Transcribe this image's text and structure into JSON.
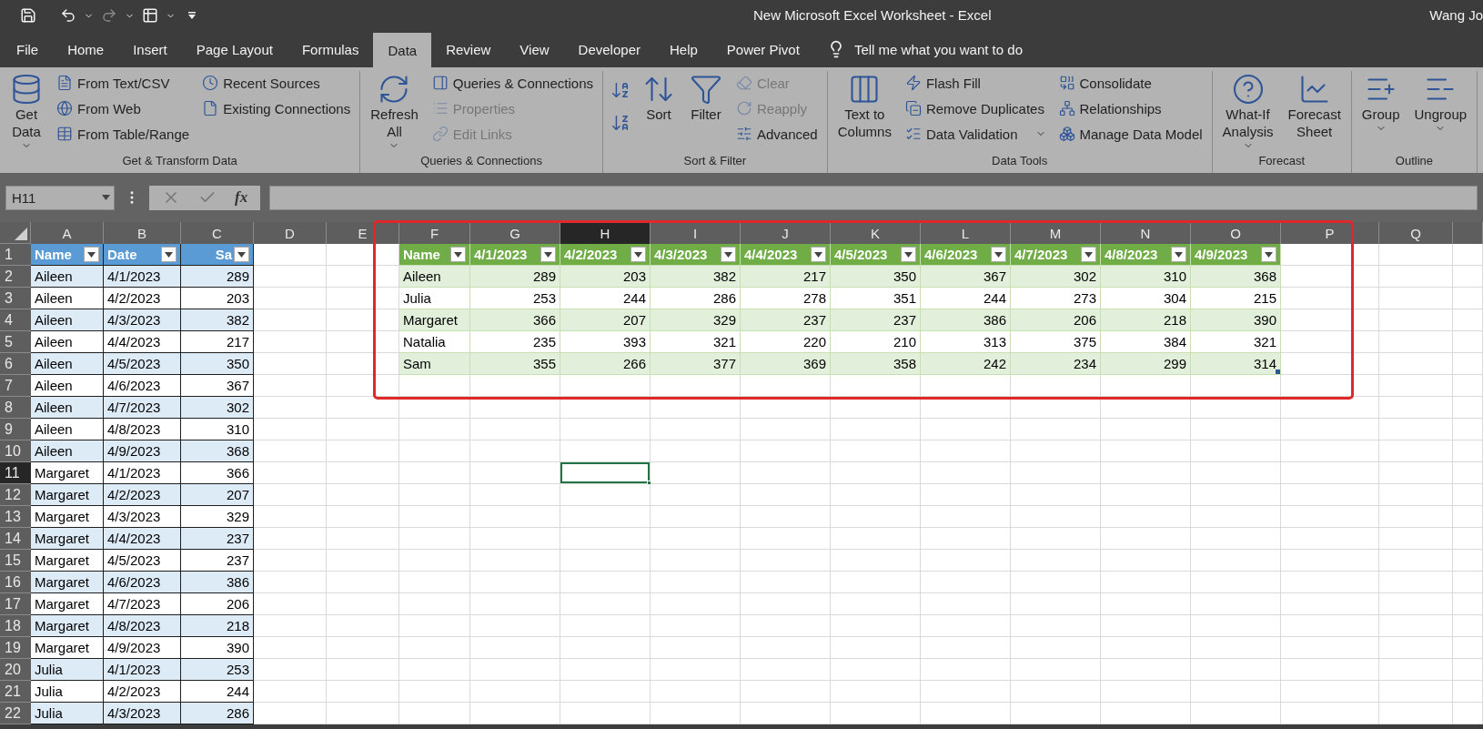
{
  "window": {
    "title": "New Microsoft Excel Worksheet  -  Excel",
    "user": "Wang Jo"
  },
  "tabs": [
    {
      "label": "File",
      "selected": false
    },
    {
      "label": "Home",
      "selected": false
    },
    {
      "label": "Insert",
      "selected": false
    },
    {
      "label": "Page Layout",
      "selected": false
    },
    {
      "label": "Formulas",
      "selected": false
    },
    {
      "label": "Data",
      "selected": true
    },
    {
      "label": "Review",
      "selected": false
    },
    {
      "label": "View",
      "selected": false
    },
    {
      "label": "Developer",
      "selected": false
    },
    {
      "label": "Help",
      "selected": false
    },
    {
      "label": "Power Pivot",
      "selected": false
    }
  ],
  "tell_me": "Tell me what you want to do",
  "ribbon": [
    {
      "label": "Get & Transform Data",
      "columns": [
        {
          "kind": "large",
          "label": "Get\nData",
          "caret": true
        },
        {
          "kind": "stack",
          "items": [
            {
              "label": "From Text/CSV",
              "disabled": false
            },
            {
              "label": "From Web",
              "disabled": false
            },
            {
              "label": "From Table/Range",
              "disabled": false
            }
          ]
        },
        {
          "kind": "stack",
          "items": [
            {
              "label": "Recent Sources",
              "disabled": false
            },
            {
              "label": "Existing Connections",
              "disabled": false
            }
          ]
        }
      ]
    },
    {
      "label": "Queries & Connections",
      "columns": [
        {
          "kind": "large",
          "label": "Refresh\nAll",
          "caret": true
        },
        {
          "kind": "stack",
          "items": [
            {
              "label": "Queries & Connections",
              "disabled": false
            },
            {
              "label": "Properties",
              "disabled": true
            },
            {
              "label": "Edit Links",
              "disabled": true
            }
          ]
        }
      ]
    },
    {
      "label": "Sort & Filter",
      "columns": [
        {
          "kind": "pair"
        },
        {
          "kind": "large",
          "label": "Sort",
          "caret": false
        },
        {
          "kind": "large",
          "label": "Filter",
          "caret": false
        },
        {
          "kind": "stack",
          "items": [
            {
              "label": "Clear",
              "disabled": true
            },
            {
              "label": "Reapply",
              "disabled": true
            },
            {
              "label": "Advanced",
              "disabled": false
            }
          ]
        }
      ]
    },
    {
      "label": "Data Tools",
      "columns": [
        {
          "kind": "large",
          "label": "Text to\nColumns",
          "caret": false
        },
        {
          "kind": "stack",
          "items": [
            {
              "label": "Flash Fill",
              "disabled": false
            },
            {
              "label": "Remove Duplicates",
              "disabled": false
            },
            {
              "label": "Data Validation",
              "disabled": false,
              "caret": true
            }
          ]
        },
        {
          "kind": "stack",
          "items": [
            {
              "label": "Consolidate",
              "disabled": false
            },
            {
              "label": "Relationships",
              "disabled": false
            },
            {
              "label": "Manage Data Model",
              "disabled": false
            }
          ]
        }
      ]
    },
    {
      "label": "Forecast",
      "columns": [
        {
          "kind": "large",
          "label": "What-If\nAnalysis",
          "caret": true
        },
        {
          "kind": "large",
          "label": "Forecast\nSheet",
          "caret": false
        }
      ]
    },
    {
      "label": "Outline",
      "columns": [
        {
          "kind": "large",
          "label": "Group",
          "caret": true
        },
        {
          "kind": "large",
          "label": "Ungroup",
          "caret": true
        }
      ]
    }
  ],
  "name_box": "H11",
  "formula_bar": {
    "function_label": "fx"
  },
  "sheet": {
    "columns": [
      {
        "label": "A",
        "selected": false
      },
      {
        "label": "B",
        "selected": false
      },
      {
        "label": "C",
        "selected": false
      },
      {
        "label": "D",
        "selected": false
      },
      {
        "label": "E",
        "selected": false
      },
      {
        "label": "F",
        "selected": false
      },
      {
        "label": "G",
        "selected": false
      },
      {
        "label": "H",
        "selected": true
      },
      {
        "label": "I",
        "selected": false
      },
      {
        "label": "J",
        "selected": false
      },
      {
        "label": "K",
        "selected": false
      },
      {
        "label": "L",
        "selected": false
      },
      {
        "label": "M",
        "selected": false
      },
      {
        "label": "N",
        "selected": false
      },
      {
        "label": "O",
        "selected": false
      },
      {
        "label": "P",
        "selected": false
      },
      {
        "label": "Q",
        "selected": false
      }
    ],
    "row_numbers": [
      {
        "label": "1",
        "selected": false
      },
      {
        "label": "2",
        "selected": false
      },
      {
        "label": "3",
        "selected": false
      },
      {
        "label": "4",
        "selected": false
      },
      {
        "label": "5",
        "selected": false
      },
      {
        "label": "6",
        "selected": false
      },
      {
        "label": "7",
        "selected": false
      },
      {
        "label": "8",
        "selected": false
      },
      {
        "label": "9",
        "selected": false
      },
      {
        "label": "10",
        "selected": false
      },
      {
        "label": "11",
        "selected": true
      },
      {
        "label": "12",
        "selected": false
      },
      {
        "label": "13",
        "selected": false
      },
      {
        "label": "14",
        "selected": false
      },
      {
        "label": "15",
        "selected": false
      },
      {
        "label": "16",
        "selected": false
      },
      {
        "label": "17",
        "selected": false
      },
      {
        "label": "18",
        "selected": false
      },
      {
        "label": "19",
        "selected": false
      },
      {
        "label": "20",
        "selected": false
      },
      {
        "label": "21",
        "selected": false
      },
      {
        "label": "22",
        "selected": false
      }
    ],
    "tables": [
      {
        "kind": "blue",
        "columns": [
          {
            "label": "Name",
            "kind": "text"
          },
          {
            "label": "Date",
            "kind": "text"
          },
          {
            "label": "Sa",
            "kind": "number"
          }
        ],
        "rows": [
          [
            "Aileen",
            "4/1/2023",
            "289"
          ],
          [
            "Aileen",
            "4/2/2023",
            "203"
          ],
          [
            "Aileen",
            "4/3/2023",
            "382"
          ],
          [
            "Aileen",
            "4/4/2023",
            "217"
          ],
          [
            "Aileen",
            "4/5/2023",
            "350"
          ],
          [
            "Aileen",
            "4/6/2023",
            "367"
          ],
          [
            "Aileen",
            "4/7/2023",
            "302"
          ],
          [
            "Aileen",
            "4/8/2023",
            "310"
          ],
          [
            "Aileen",
            "4/9/2023",
            "368"
          ],
          [
            "Margaret",
            "4/1/2023",
            "366"
          ],
          [
            "Margaret",
            "4/2/2023",
            "207"
          ],
          [
            "Margaret",
            "4/3/2023",
            "329"
          ],
          [
            "Margaret",
            "4/4/2023",
            "237"
          ],
          [
            "Margaret",
            "4/5/2023",
            "237"
          ],
          [
            "Margaret",
            "4/6/2023",
            "386"
          ],
          [
            "Margaret",
            "4/7/2023",
            "206"
          ],
          [
            "Margaret",
            "4/8/2023",
            "218"
          ],
          [
            "Margaret",
            "4/9/2023",
            "390"
          ],
          [
            "Julia",
            "4/1/2023",
            "253"
          ],
          [
            "Julia",
            "4/2/2023",
            "244"
          ],
          [
            "Julia",
            "4/3/2023",
            "286"
          ]
        ]
      },
      {
        "kind": "green",
        "columns": [
          {
            "label": "Name",
            "kind": "text"
          },
          {
            "label": "4/1/2023",
            "kind": "value"
          },
          {
            "label": "4/2/2023",
            "kind": "value"
          },
          {
            "label": "4/3/2023",
            "kind": "value"
          },
          {
            "label": "4/4/2023",
            "kind": "value"
          },
          {
            "label": "4/5/2023",
            "kind": "value"
          },
          {
            "label": "4/6/2023",
            "kind": "value"
          },
          {
            "label": "4/7/2023",
            "kind": "value"
          },
          {
            "label": "4/8/2023",
            "kind": "value"
          },
          {
            "label": "4/9/2023",
            "kind": "value"
          }
        ],
        "rows": [
          [
            "Aileen",
            "289",
            "203",
            "382",
            "217",
            "350",
            "367",
            "302",
            "310",
            "368"
          ],
          [
            "Julia",
            "253",
            "244",
            "286",
            "278",
            "351",
            "244",
            "273",
            "304",
            "215"
          ],
          [
            "Margaret",
            "366",
            "207",
            "329",
            "237",
            "237",
            "386",
            "206",
            "218",
            "390"
          ],
          [
            "Natalia",
            "235",
            "393",
            "321",
            "220",
            "210",
            "313",
            "375",
            "384",
            "321"
          ],
          [
            "Sam",
            "355",
            "266",
            "377",
            "369",
            "358",
            "242",
            "234",
            "299",
            "314"
          ]
        ]
      }
    ]
  }
}
